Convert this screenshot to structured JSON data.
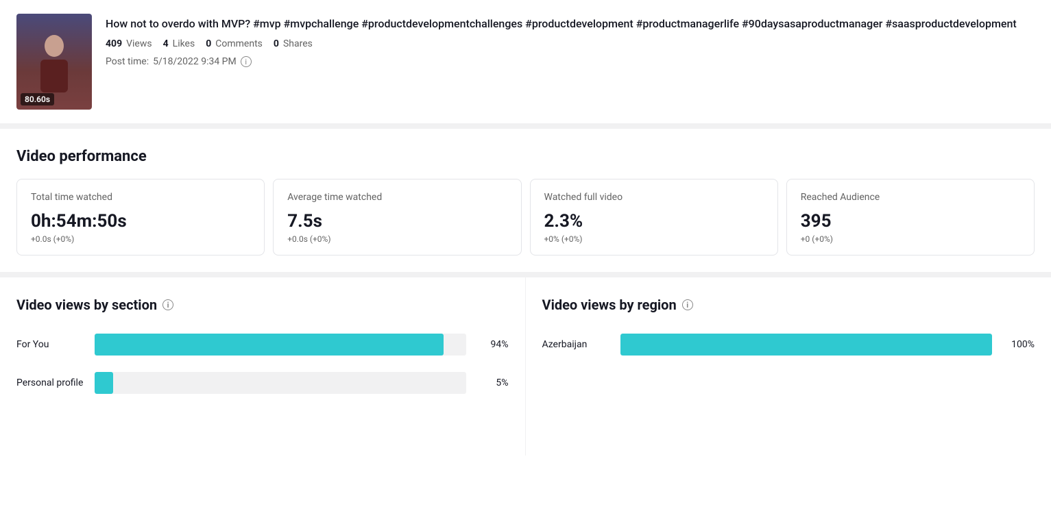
{
  "post": {
    "title": "How not to overdo with MVP? #mvp #mvpchallenge #productdevelopmentchallenges #productdevelopment #productmanagerlife #90daysasaproductmanager #saasproductdevelopment",
    "duration": "80.60s",
    "stats": {
      "views_count": "409",
      "views_label": "Views",
      "likes_count": "4",
      "likes_label": "Likes",
      "comments_count": "0",
      "comments_label": "Comments",
      "shares_count": "0",
      "shares_label": "Shares"
    },
    "post_time_label": "Post time:",
    "post_time_value": "5/18/2022 9:34 PM",
    "info_icon": "ⓘ"
  },
  "performance": {
    "section_title": "Video performance",
    "metrics": [
      {
        "label": "Total time watched",
        "value": "0h:54m:50s",
        "change": "+0.0s (+0%)"
      },
      {
        "label": "Average time watched",
        "value": "7.5s",
        "change": "+0.0s (+0%)"
      },
      {
        "label": "Watched full video",
        "value": "2.3%",
        "change": "+0% (+0%)"
      },
      {
        "label": "Reached Audience",
        "value": "395",
        "change": "+0 (+0%)"
      }
    ]
  },
  "views_by_section": {
    "title": "Video views by section",
    "bars": [
      {
        "label": "For You",
        "percent": 94,
        "display": "94%"
      },
      {
        "label": "Personal profile",
        "percent": 5,
        "display": "5%"
      }
    ]
  },
  "views_by_region": {
    "title": "Video views by region",
    "bars": [
      {
        "label": "Azerbaijan",
        "percent": 100,
        "display": "100%"
      }
    ]
  }
}
